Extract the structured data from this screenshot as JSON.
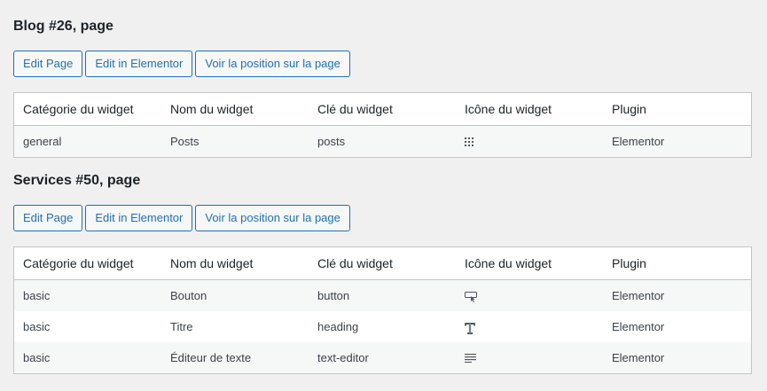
{
  "sections": [
    {
      "title": "Blog #26, page",
      "buttons": {
        "edit_page": "Edit Page",
        "edit_elementor": "Edit in Elementor",
        "view_position": "Voir la position sur la page"
      },
      "headers": [
        "Catégorie du widget",
        "Nom du widget",
        "Clé du widget",
        "Icône du widget",
        "Plugin"
      ],
      "rows": [
        {
          "category": "general",
          "name": "Posts",
          "key": "posts",
          "icon": "grid-icon",
          "plugin": "Elementor"
        }
      ]
    },
    {
      "title": "Services #50, page",
      "buttons": {
        "edit_page": "Edit Page",
        "edit_elementor": "Edit in Elementor",
        "view_position": "Voir la position sur la page"
      },
      "headers": [
        "Catégorie du widget",
        "Nom du widget",
        "Clé du widget",
        "Icône du widget",
        "Plugin"
      ],
      "rows": [
        {
          "category": "basic",
          "name": "Bouton",
          "key": "button",
          "icon": "button-icon",
          "plugin": "Elementor"
        },
        {
          "category": "basic",
          "name": "Titre",
          "key": "heading",
          "icon": "heading-icon",
          "plugin": "Elementor"
        },
        {
          "category": "basic",
          "name": "Éditeur de texte",
          "key": "text-editor",
          "icon": "text-editor-icon",
          "plugin": "Elementor"
        }
      ]
    }
  ],
  "colors": {
    "accent": "#2271b1",
    "background": "#f0f0f1",
    "border": "#c3c4c7"
  }
}
